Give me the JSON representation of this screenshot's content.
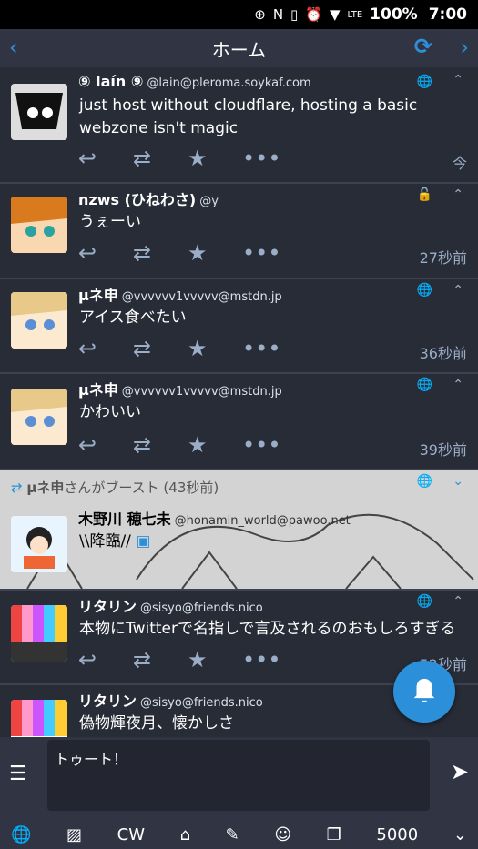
{
  "status": {
    "battery": "100%",
    "time": "7:00",
    "network": "LTE"
  },
  "header": {
    "title": "ホーム"
  },
  "posts": [
    {
      "name": "⑨ laín ⑨",
      "acct": "@lain@pleroma.soykaf.com",
      "content": "just host without cloudflare, hosting a basic webzone isn't magic",
      "time": "今"
    },
    {
      "name": "nzws (ひねわさ)",
      "acct": "@y",
      "content": "うぇーい",
      "time": "27秒前"
    },
    {
      "name": "μネ申",
      "acct": "@vvvvvv1vvvvv@mstdn.jp",
      "content": "アイス食べたい",
      "time": "36秒前"
    },
    {
      "name": "μネ申",
      "acct": "@vvvvvv1vvvvv@mstdn.jp",
      "content": "かわいい",
      "time": "39秒前"
    },
    {
      "boost_by": "μネ申",
      "boost_text": "さんがブースト (43秒前)",
      "name": "木野川 穂七未",
      "acct": "@honamin_world@pawoo.net",
      "content": "\\\\降臨//"
    },
    {
      "name": "リタリン",
      "acct": "@sisyo@friends.nico",
      "content": "本物にTwitterで名指しで言及されるのおもしろすぎる",
      "time": "52秒前"
    },
    {
      "name": "リタリン",
      "acct": "@sisyo@friends.nico",
      "content": "偽物輝夜月、懐かしさ"
    }
  ],
  "composer": {
    "placeholder": "トゥート！",
    "cw_label": "CW",
    "char_count": "5000"
  },
  "colors": {
    "accent": "#2b90d9",
    "bg": "#282c37",
    "header_bg": "#313543",
    "action": "#9baec8",
    "boosted_bg": "#d3d3d3"
  }
}
